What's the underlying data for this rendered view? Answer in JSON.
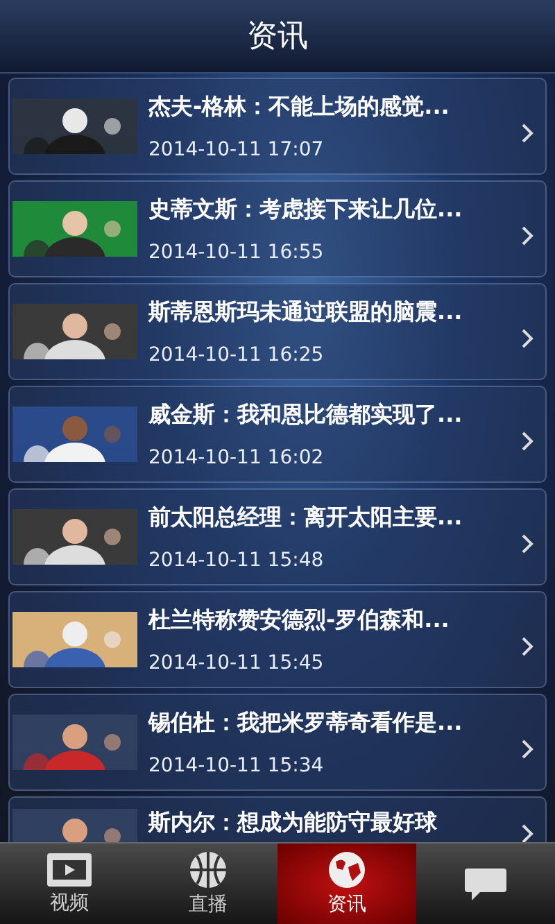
{
  "header": {
    "title": "资讯"
  },
  "news": [
    {
      "title": "杰夫-格林：不能上场的感觉...",
      "time": "2014-10-11 17:07"
    },
    {
      "title": "史蒂文斯：考虑接下来让几位...",
      "time": "2014-10-11 16:55"
    },
    {
      "title": "斯蒂恩斯玛未通过联盟的脑震...",
      "time": "2014-10-11 16:25"
    },
    {
      "title": "威金斯：我和恩比德都实现了...",
      "time": "2014-10-11 16:02"
    },
    {
      "title": "前太阳总经理：离开太阳主要...",
      "time": "2014-10-11 15:48"
    },
    {
      "title": "杜兰特称赞安德烈-罗伯森和...",
      "time": "2014-10-11 15:45"
    },
    {
      "title": "锡伯杜：我把米罗蒂奇看作是...",
      "time": "2014-10-11 15:34"
    },
    {
      "title": "斯内尔：想成为能防守最好球"
    }
  ],
  "tabs": [
    {
      "label": "视频",
      "selected": false
    },
    {
      "label": "直播",
      "selected": false
    },
    {
      "label": "资讯",
      "selected": true
    },
    {
      "selected": false
    }
  ]
}
